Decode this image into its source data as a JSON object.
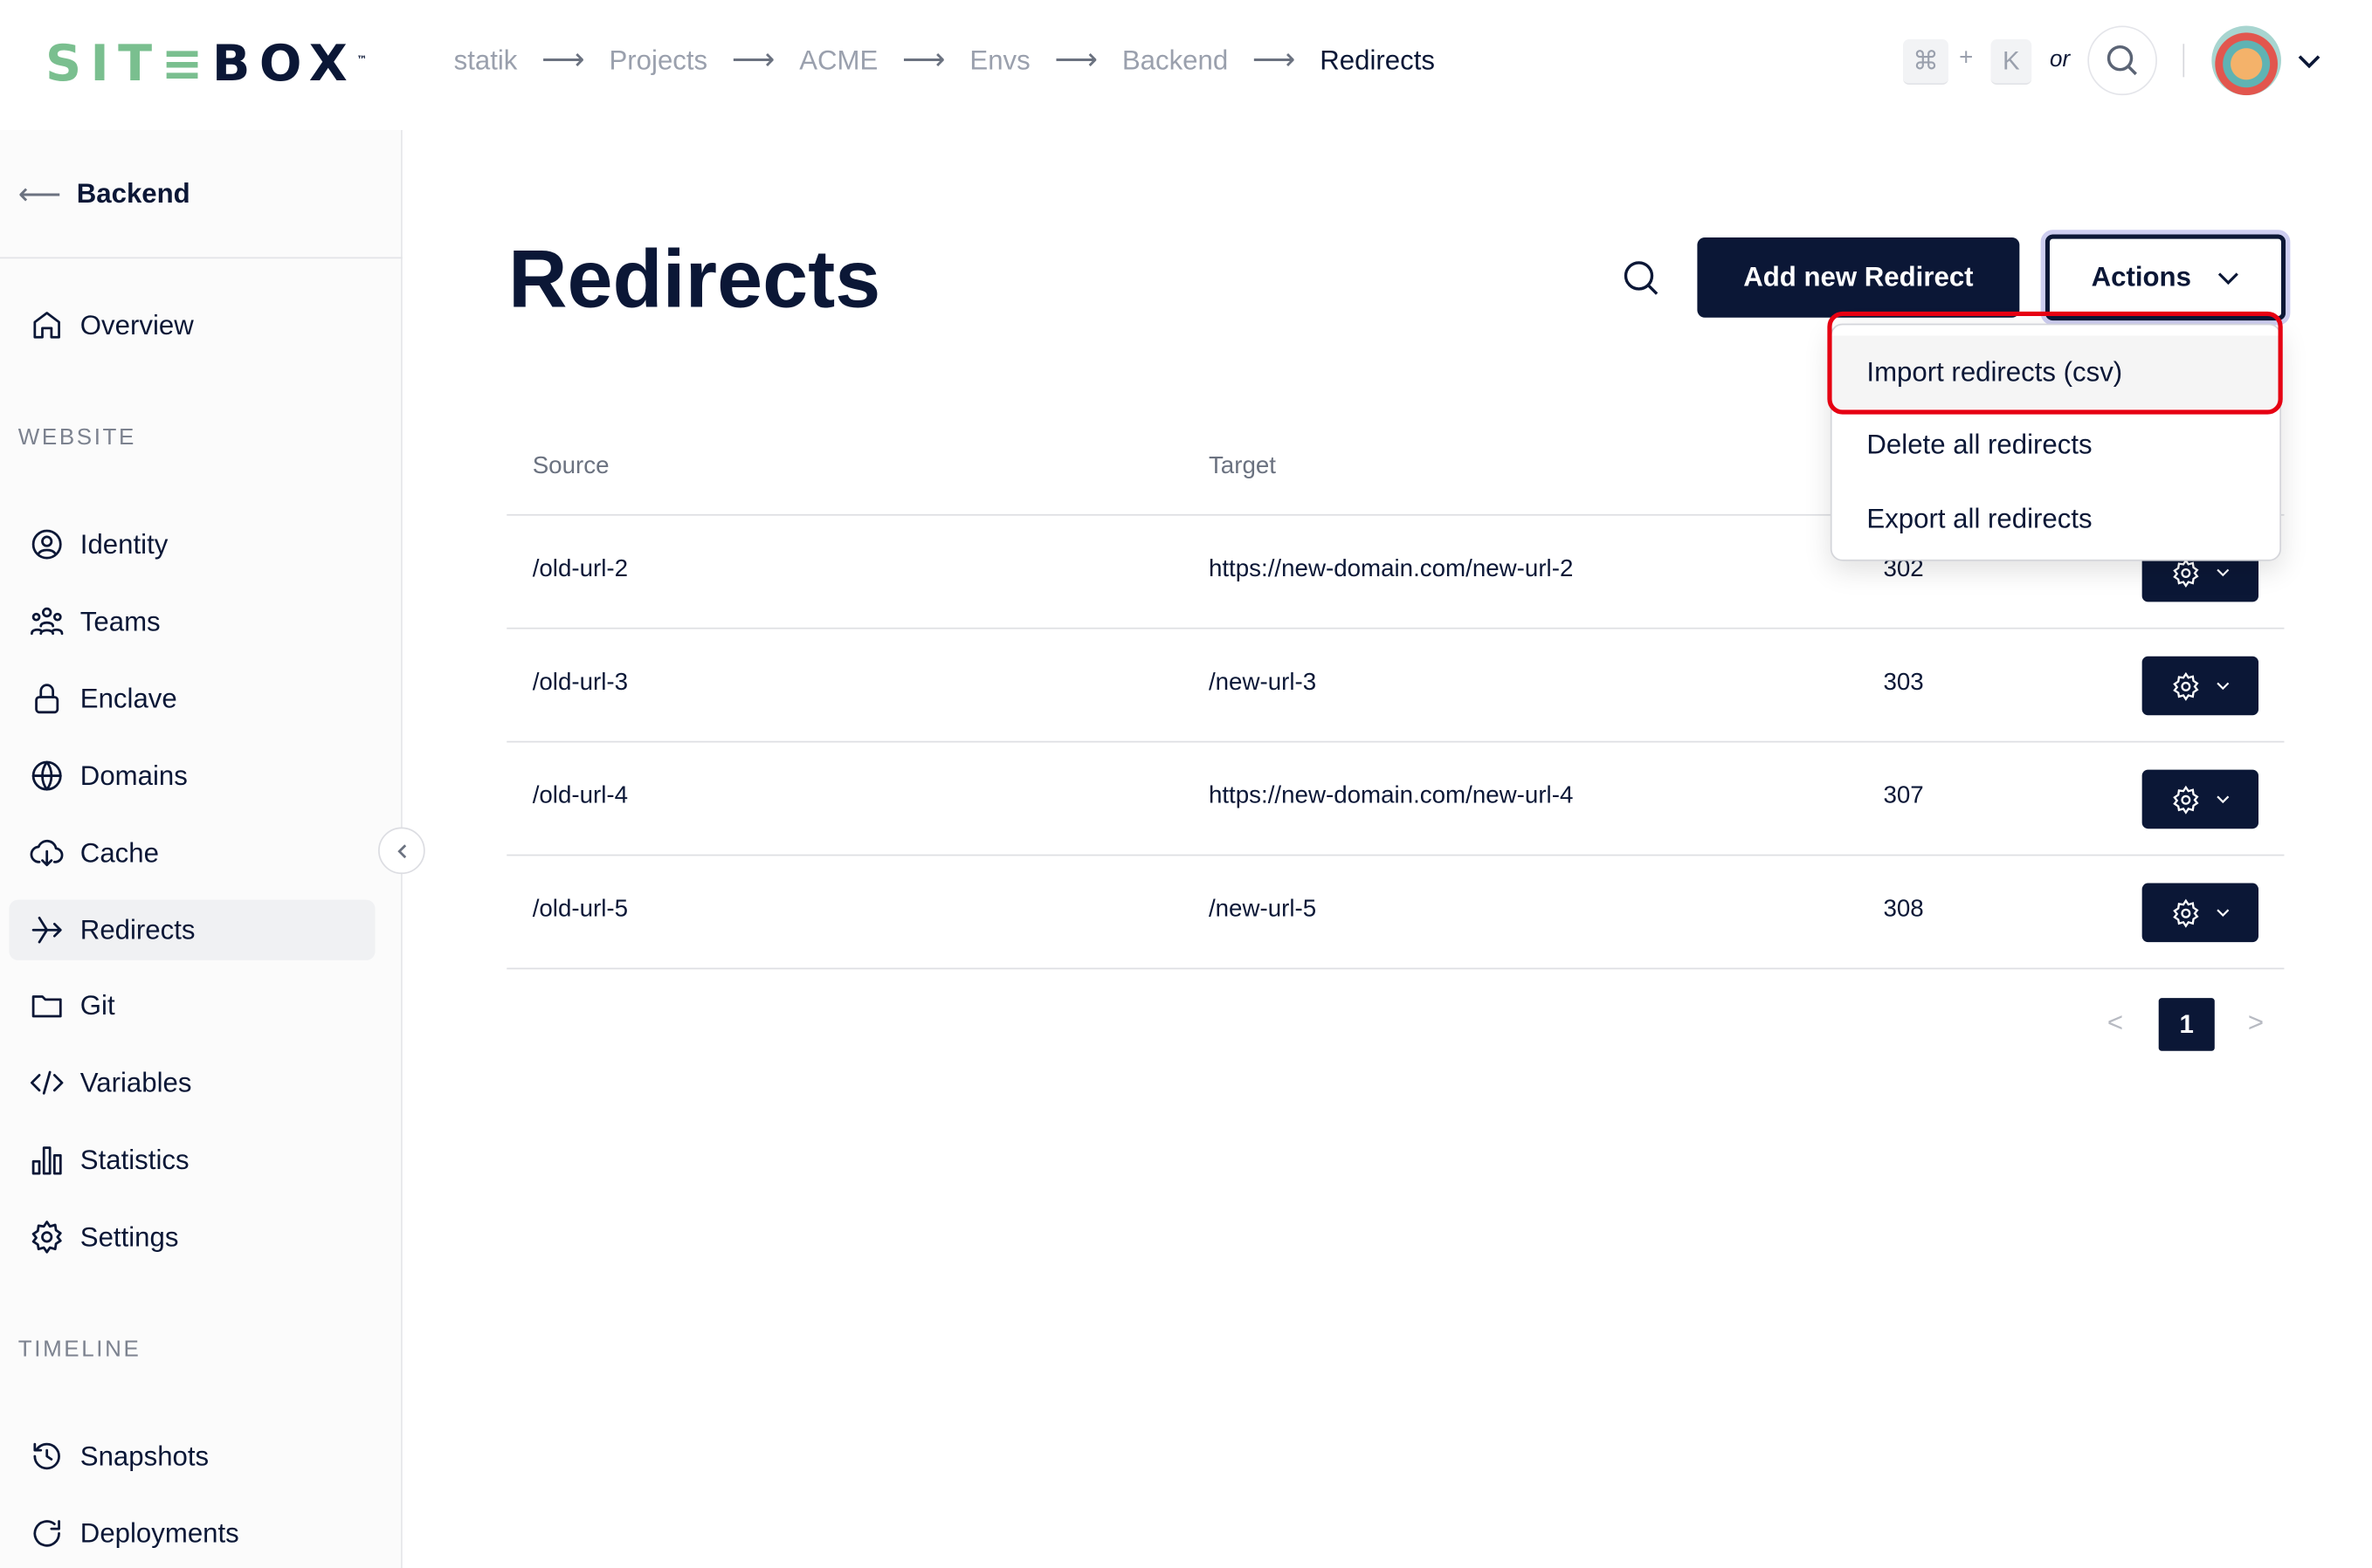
{
  "logo": {
    "text_green": "SIT≡",
    "text_dark": "BOX",
    "tm": "™"
  },
  "breadcrumb": [
    "statik",
    "Projects",
    "ACME",
    "Envs",
    "Backend",
    "Redirects"
  ],
  "header": {
    "shortcut_key1": "⌘",
    "plus": "+",
    "shortcut_key2": "K",
    "or": "or"
  },
  "sidebar": {
    "back_label": "Backend",
    "overview": "Overview",
    "section_website": "WEBSITE",
    "items": [
      "Identity",
      "Teams",
      "Enclave",
      "Domains",
      "Cache",
      "Redirects",
      "Git",
      "Variables",
      "Statistics",
      "Settings"
    ],
    "active": "Redirects",
    "section_timeline": "TIMELINE",
    "timeline_items": [
      "Snapshots",
      "Deployments"
    ]
  },
  "main": {
    "title": "Redirects",
    "add_button": "Add new Redirect",
    "actions_button": "Actions",
    "columns": {
      "source": "Source",
      "target": "Target"
    },
    "rows": [
      {
        "source": "/old-url-2",
        "target": "https://new-domain.com/new-url-2",
        "code": "302"
      },
      {
        "source": "/old-url-3",
        "target": "/new-url-3",
        "code": "303"
      },
      {
        "source": "/old-url-4",
        "target": "https://new-domain.com/new-url-4",
        "code": "307"
      },
      {
        "source": "/old-url-5",
        "target": "/new-url-5",
        "code": "308"
      }
    ],
    "pagination": {
      "prev": "<",
      "current": "1",
      "next": ">"
    }
  },
  "actions_menu": [
    "Import redirects (csv)",
    "Delete all redirects",
    "Export all redirects"
  ],
  "colors": {
    "brand_dark": "#0b1736",
    "brand_green": "#7abf8f",
    "highlight": "#e60012"
  }
}
